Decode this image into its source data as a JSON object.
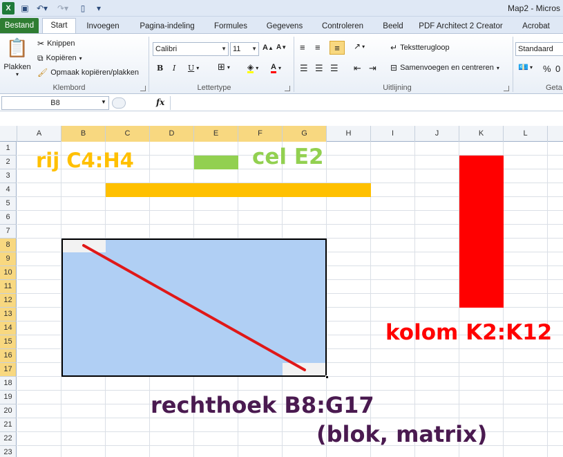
{
  "app": {
    "title": "Map2 - Micros",
    "quick_access": [
      "excel-icon",
      "save-icon",
      "undo-icon",
      "redo-icon",
      "new-icon",
      "customize-icon"
    ]
  },
  "tabs": [
    {
      "label": "Bestand",
      "kind": "file"
    },
    {
      "label": "Start",
      "kind": "active"
    },
    {
      "label": "Invoegen"
    },
    {
      "label": "Pagina-indeling"
    },
    {
      "label": "Formules"
    },
    {
      "label": "Gegevens"
    },
    {
      "label": "Controleren"
    },
    {
      "label": "Beeld"
    },
    {
      "label": "PDF Architect 2 Creator"
    },
    {
      "label": "Acrobat"
    }
  ],
  "ribbon": {
    "clipboard": {
      "group_label": "Klembord",
      "paste": "Plakken",
      "cut": "Knippen",
      "copy": "Kopiëren",
      "format_painter": "Opmaak kopiëren/plakken"
    },
    "font": {
      "group_label": "Lettertype",
      "font_name": "Calibri",
      "font_size": "11",
      "bold": "B",
      "italic": "I",
      "underline": "U",
      "font_color": "A"
    },
    "alignment": {
      "group_label": "Uitlijning",
      "wrap_text": "Tekstterugloop",
      "merge_center": "Samenvoegen en centreren"
    },
    "number": {
      "group_label": "Geta",
      "format": "Standaard",
      "percent": "%",
      "thousands": "0"
    }
  },
  "formula_bar": {
    "name_box": "B8",
    "fx": "fx",
    "value": ""
  },
  "sheet": {
    "columns": [
      "A",
      "B",
      "C",
      "D",
      "E",
      "F",
      "G",
      "H",
      "I",
      "J",
      "K",
      "L"
    ],
    "selected_columns": [
      "B",
      "C",
      "D",
      "E",
      "F",
      "G"
    ],
    "rows": [
      "1",
      "2",
      "3",
      "4",
      "5",
      "6",
      "7",
      "8",
      "9",
      "10",
      "11",
      "12",
      "13",
      "14",
      "15",
      "16",
      "17",
      "18",
      "19",
      "20",
      "21",
      "22",
      "23"
    ],
    "selected_rows": [
      "8",
      "9",
      "10",
      "11",
      "12",
      "13",
      "14",
      "15",
      "16",
      "17"
    ]
  },
  "annotations": {
    "row_label": "rij C4:H4",
    "cell_label": "cel E2",
    "column_label": "kolom K2:K12",
    "rect_label": "rechthoek B8:G17",
    "rect_sublabel": "(blok, matrix)"
  },
  "colors": {
    "row_bar": "#ffc000",
    "cell_fill": "#92d050",
    "column_bar": "#ff0000",
    "rect_fill": "#b0cff4",
    "rect_label": "#4a1a50",
    "diagonal": "#e01818"
  }
}
